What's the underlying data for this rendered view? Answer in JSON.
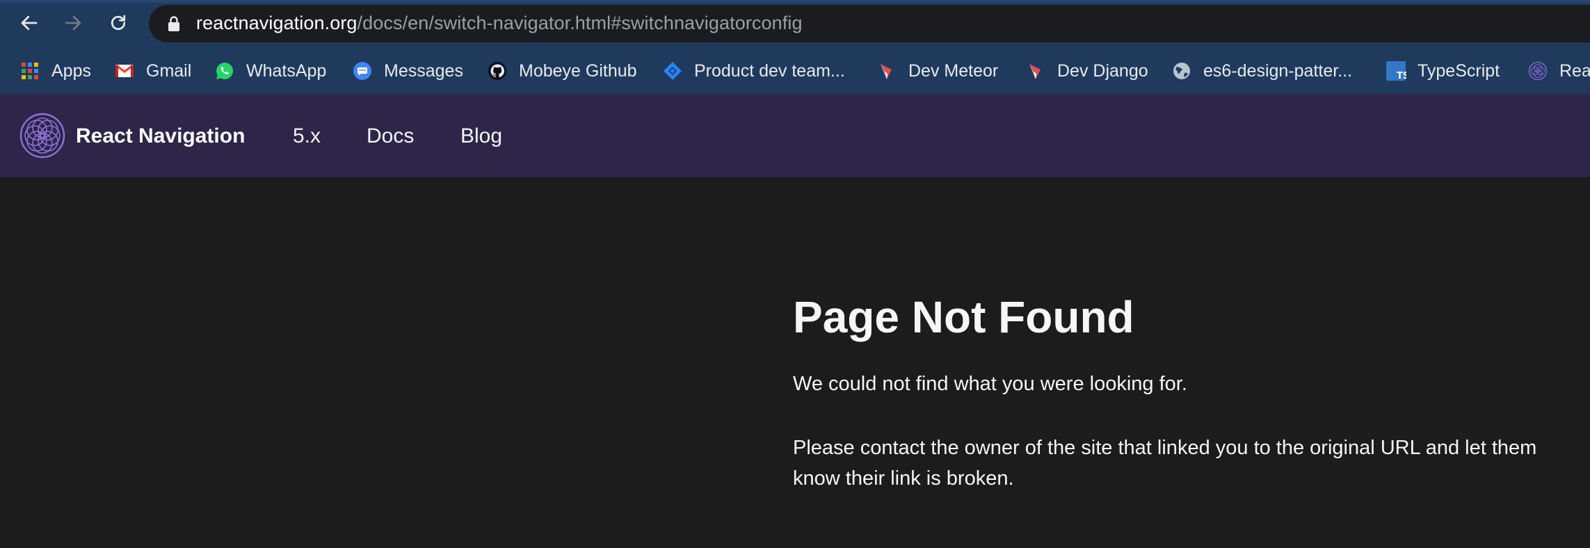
{
  "browser": {
    "url_host": "reactnavigation.org",
    "url_path": "/docs/en/switch-navigator.html#switchnavigatorconfig",
    "bookmarks": [
      {
        "label": "Apps",
        "icon": "apps-grid-icon"
      },
      {
        "label": "Gmail",
        "icon": "gmail-icon"
      },
      {
        "label": "WhatsApp",
        "icon": "whatsapp-icon"
      },
      {
        "label": "Messages",
        "icon": "messages-icon"
      },
      {
        "label": "Mobeye Github",
        "icon": "github-icon"
      },
      {
        "label": "Product dev team...",
        "icon": "jira-icon"
      },
      {
        "label": "Dev Meteor",
        "icon": "meteor-icon"
      },
      {
        "label": "Dev Django",
        "icon": "django-icon"
      },
      {
        "label": "es6-design-patter...",
        "icon": "globe-icon"
      },
      {
        "label": "TypeScript",
        "icon": "typescript-icon"
      },
      {
        "label": "Rea",
        "icon": "react-navigation-icon"
      }
    ]
  },
  "site": {
    "brand": "React Navigation",
    "nav": [
      "5.x",
      "Docs",
      "Blog"
    ]
  },
  "content": {
    "title": "Page Not Found",
    "paragraph1": "We could not find what you were looking for.",
    "paragraph2": "Please contact the owner of the site that linked you to the original URL and let them know their link is broken."
  }
}
